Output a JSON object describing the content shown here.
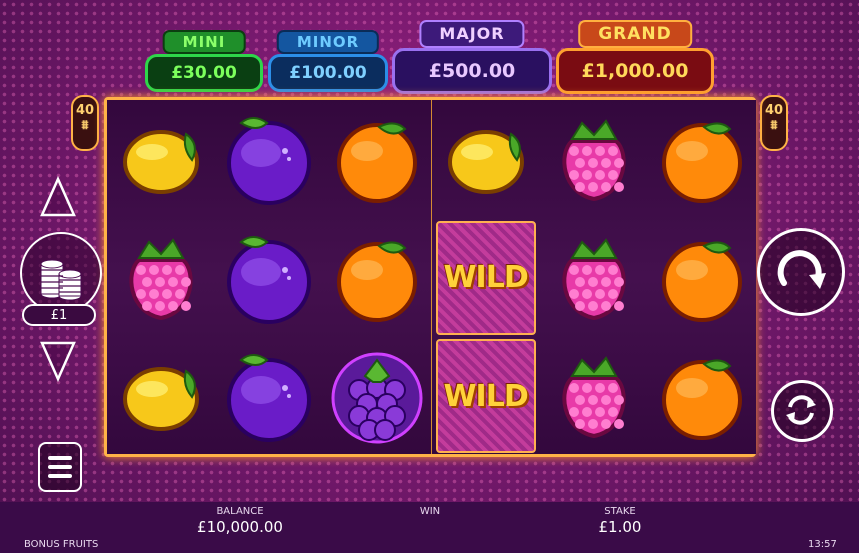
{
  "jackpots": {
    "mini": {
      "label": "MINI",
      "value": "£30.00"
    },
    "minor": {
      "label": "MINOR",
      "value": "£100.00"
    },
    "major": {
      "label": "MAJOR",
      "value": "£500.00"
    },
    "grand": {
      "label": "GRAND",
      "value": "£1,000.00"
    }
  },
  "ways": {
    "number": "40",
    "symbol": "⩩"
  },
  "reels": [
    [
      "lemon",
      "raspberry",
      "lemon"
    ],
    [
      "plum",
      "plum",
      "plum"
    ],
    [
      "orange",
      "orange",
      "grapes"
    ],
    [
      "lemon",
      "wild",
      "wild"
    ],
    [
      "raspberry",
      "raspberry",
      "raspberry"
    ],
    [
      "orange",
      "orange",
      "orange"
    ]
  ],
  "wild_label": "WILD",
  "controls": {
    "stake_value": "£1",
    "stake_up_icon": "triangle-up-icon",
    "stake_down_icon": "triangle-down-icon",
    "spin_icon": "spin-arrow-icon",
    "autoplay_icon": "autoplay-icon",
    "menu_icon": "hamburger-menu-icon"
  },
  "bottom_bar": {
    "balance_label": "BALANCE",
    "balance_value": "£10,000.00",
    "win_label": "WIN",
    "stake_label": "STAKE",
    "stake_value": "£1.00",
    "game_name": "BONUS FRUITS",
    "clock": "13:57"
  },
  "colors": {
    "frame": "#ffb347",
    "accent_gold": "#ffd23a"
  }
}
